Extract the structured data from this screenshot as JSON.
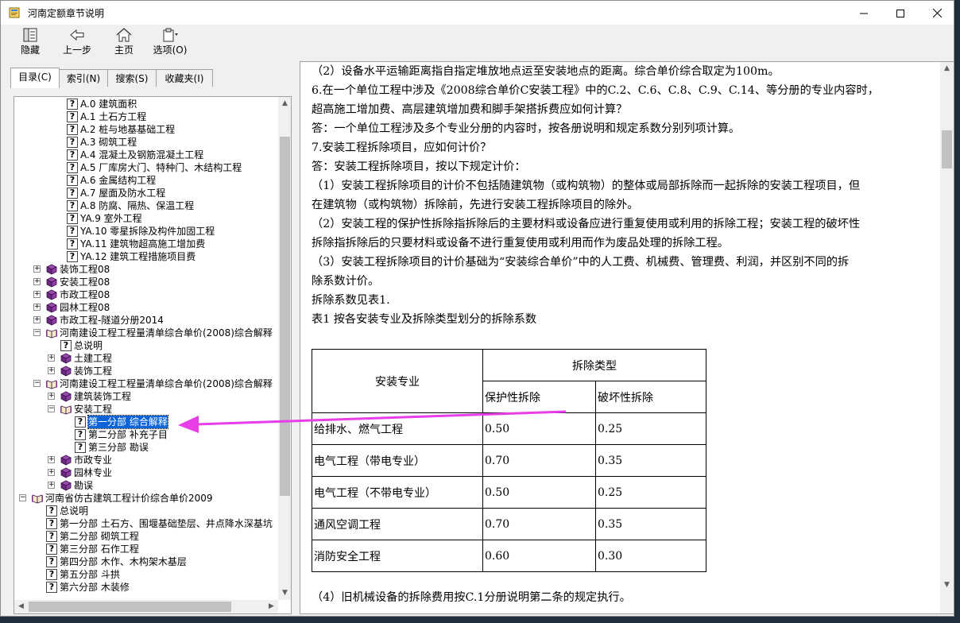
{
  "window": {
    "title": "河南定额章节说明"
  },
  "toolbar": {
    "hide_label": "隐藏",
    "back_label": "上一步",
    "home_label": "主页",
    "options_label": "选项(O)"
  },
  "tabs": [
    {
      "label": "目录(C)"
    },
    {
      "label": "索引(N)"
    },
    {
      "label": "搜索(S)"
    },
    {
      "label": "收藏夹(I)"
    }
  ],
  "tree": [
    {
      "text": "A.0 建筑面积"
    },
    {
      "text": "A.1 土石方工程"
    },
    {
      "text": "A.2 桩与地基基础工程"
    },
    {
      "text": "A.3 砌筑工程"
    },
    {
      "text": "A.4 混凝土及钢筋混凝土工程"
    },
    {
      "text": "A.5 厂库房大门、特种门、木结构工程"
    },
    {
      "text": "A.6 金属结构工程"
    },
    {
      "text": "A.7 屋面及防水工程"
    },
    {
      "text": "A.8 防腐、隔热、保温工程"
    },
    {
      "text": "YA.9 室外工程"
    },
    {
      "text": "YA.10 零星拆除及构件加固工程"
    },
    {
      "text": "YA.11 建筑物超高施工增加费"
    },
    {
      "text": "YA.12 建筑工程措施项目费"
    },
    {
      "text": "装饰工程08"
    },
    {
      "text": "安装工程08"
    },
    {
      "text": "市政工程08"
    },
    {
      "text": "园林工程08"
    },
    {
      "text": "市政工程-隧道分册2014"
    },
    {
      "text": "河南建设工程工程量清单综合单价(2008)综合解释"
    },
    {
      "text": "总说明"
    },
    {
      "text": "土建工程"
    },
    {
      "text": "装饰工程"
    },
    {
      "text": "河南建设工程工程量清单综合单价(2008)综合解释"
    },
    {
      "text": "建筑装饰工程"
    },
    {
      "text": "安装工程"
    },
    {
      "text": "第一分部 综合解释"
    },
    {
      "text": "第二分部 补充子目"
    },
    {
      "text": "第三分部 勘误"
    },
    {
      "text": "市政专业"
    },
    {
      "text": "园林专业"
    },
    {
      "text": "勘误"
    },
    {
      "text": "河南省仿古建筑工程计价综合单价2009"
    },
    {
      "text": "总说明"
    },
    {
      "text": "第一分部 土石方、围堰基础垫层、井点降水深基坑"
    },
    {
      "text": "第二分部 砌筑工程"
    },
    {
      "text": "第三分部 石作工程"
    },
    {
      "text": "第四分部 木作、木构架木基层"
    },
    {
      "text": "第五分部 斗拱"
    },
    {
      "text": "第六分部 木装修"
    }
  ],
  "content": {
    "paragraphs": [
      "（2）设备水平运输距离指自指定堆放地点运至安装地点的距离。综合单价综合取定为100m。",
      "6.在一个单位工程中涉及《2008综合单价C安装工程》中的C.2、C.6、C.8、C.9、C.14、等分册的专业内容时，",
      "超高施工增加费、高层建筑增加费和脚手架搭拆费应如何计算？",
      "答：一个单位工程涉及多个专业分册的内容时，按各册说明和规定系数分别列项计算。",
      "7.安装工程拆除项目，应如何计价？",
      "答：安装工程拆除项目，按以下规定计价：",
      "（1）安装工程拆除项目的计价不包括随建筑物（或构筑物）的整体或局部拆除而一起拆除的安装工程项目，但",
      "在建筑物（或构筑物）拆除前，先进行安装工程拆除项目的除外。",
      "（2）安装工程的保护性拆除指拆除后的主要材料或设备应进行重复使用或利用的拆除工程；安装工程的破坏性",
      "拆除指拆除后的只要材料或设备不进行重复使用或利用而作为废品处理的拆除工程。",
      "（3）安装工程拆除项目的计价基础为“安装综合单价”中的人工费、机械费、管理费、利润，并区别不同的拆",
      "除系数计价。",
      "拆除系数见表1.",
      "表1 按各安装专业及拆除类型划分的拆除系数"
    ],
    "table": {
      "header_major": "安装专业",
      "header_group": "拆除类型",
      "header_protect": "保护性拆除",
      "header_destroy": "破坏性拆除",
      "rows": [
        {
          "major": "给排水、燃气工程",
          "protect": "0.50",
          "destroy": "0.25"
        },
        {
          "major": "电气工程（带电专业）",
          "protect": "0.70",
          "destroy": "0.35"
        },
        {
          "major": "电气工程（不带电专业）",
          "protect": "0.50",
          "destroy": "0.25"
        },
        {
          "major": "通风空调工程",
          "protect": "0.70",
          "destroy": "0.35"
        },
        {
          "major": "消防安全工程",
          "protect": "0.60",
          "destroy": "0.30"
        }
      ]
    },
    "footer_line": "（4）旧机械设备的拆除费用按C.1分册说明第二条的规定执行。"
  },
  "colors": {
    "selection": "#0a64d8",
    "arrow": "#e83ee8",
    "book": "#7a2a8c"
  }
}
